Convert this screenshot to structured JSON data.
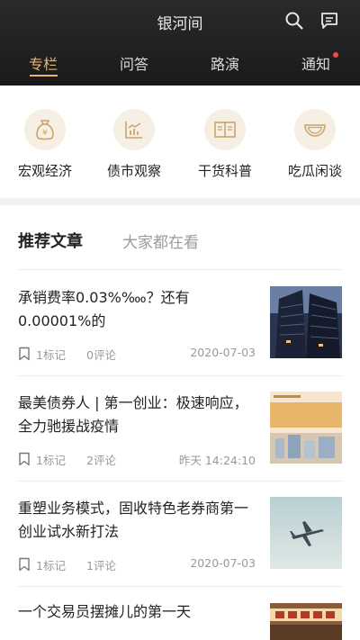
{
  "header": {
    "title": "银河间",
    "tabs": [
      {
        "label": "专栏",
        "active": true
      },
      {
        "label": "问答",
        "active": false
      },
      {
        "label": "路演",
        "active": false
      },
      {
        "label": "通知",
        "active": false,
        "badge": "red-dot"
      }
    ],
    "icons": [
      "search-icon",
      "message-icon"
    ],
    "accent_color": "#e8b56a"
  },
  "categories": [
    {
      "label": "宏观经济",
      "icon": "money-bag-icon"
    },
    {
      "label": "债市观察",
      "icon": "chart-icon"
    },
    {
      "label": "干货科普",
      "icon": "book-icon"
    },
    {
      "label": "吃瓜闲谈",
      "icon": "watermelon-icon"
    }
  ],
  "feed": {
    "tabs": [
      {
        "label": "推荐文章",
        "active": true
      },
      {
        "label": "大家都在看",
        "active": false
      }
    ],
    "articles": [
      {
        "title": "承销费率0.03%‱？还有0.00001%的",
        "marks": "1标记",
        "comments": "0评论",
        "date": "2020-07-03",
        "thumb": "skyscraper-image"
      },
      {
        "title": "最美债券人 | 第一创业：极速响应，全力驰援战疫情",
        "marks": "1标记",
        "comments": "2评论",
        "date": "昨天 14:24:10",
        "thumb": "bond-poster-image"
      },
      {
        "title": "重塑业务模式，固收特色老券商第一创业试水新打法",
        "marks": "1标记",
        "comments": "1评论",
        "date": "2020-07-03",
        "thumb": "airplane-image"
      },
      {
        "title": "一个交易员摆摊儿的第一天",
        "marks": "",
        "comments": "",
        "date": "",
        "thumb": "street-stall-image"
      }
    ]
  }
}
